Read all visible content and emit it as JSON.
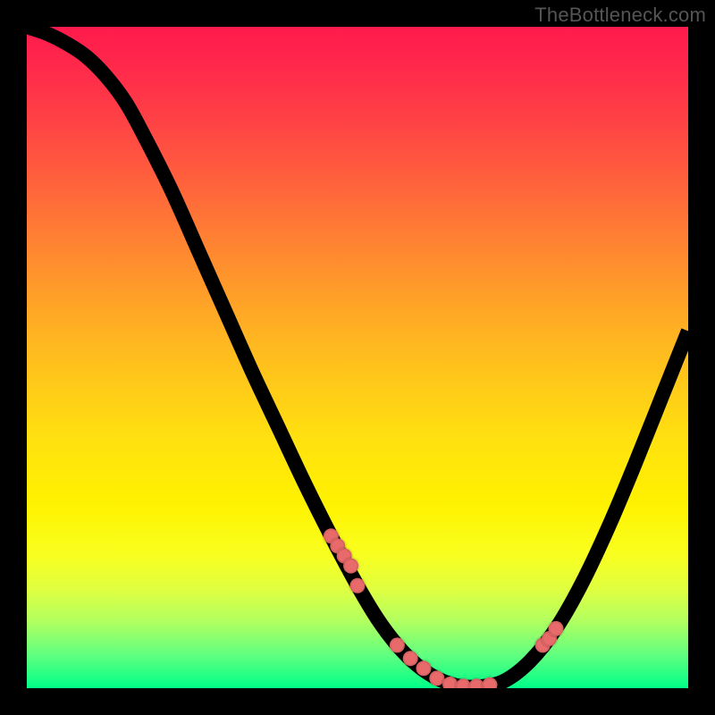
{
  "watermark": "TheBottleneck.com",
  "chart_data": {
    "type": "line",
    "title": "",
    "xlabel": "",
    "ylabel": "",
    "xlim": [
      0,
      100
    ],
    "ylim": [
      0,
      100
    ],
    "curve": {
      "x": [
        0,
        3,
        6,
        9,
        12,
        15,
        18,
        22,
        26,
        30,
        34,
        38,
        42,
        46,
        50,
        53,
        56,
        59,
        62,
        65,
        68,
        72,
        76,
        80,
        84,
        88,
        92,
        96,
        100
      ],
      "y": [
        100,
        99,
        97.5,
        95.5,
        92.5,
        88.5,
        83,
        75,
        66,
        57,
        48,
        39.5,
        31,
        23,
        15.5,
        10.5,
        6.5,
        3.5,
        1.5,
        0.4,
        0.2,
        1,
        4,
        9,
        16,
        24.5,
        34,
        44,
        54
      ]
    },
    "markers": {
      "x": [
        46,
        47,
        48,
        49,
        50,
        56,
        58,
        60,
        62,
        64,
        66,
        68,
        70,
        78,
        79,
        80
      ],
      "y": [
        23,
        21.5,
        20,
        18.5,
        15.5,
        6.5,
        4.5,
        3,
        1.5,
        0.6,
        0.3,
        0.3,
        0.5,
        6.5,
        7.5,
        9
      ]
    },
    "colors": {
      "curve": "#000000",
      "markers": "#e86a6a",
      "gradient_top": "#ff1a4d",
      "gradient_bottom": "#00ff88"
    }
  }
}
